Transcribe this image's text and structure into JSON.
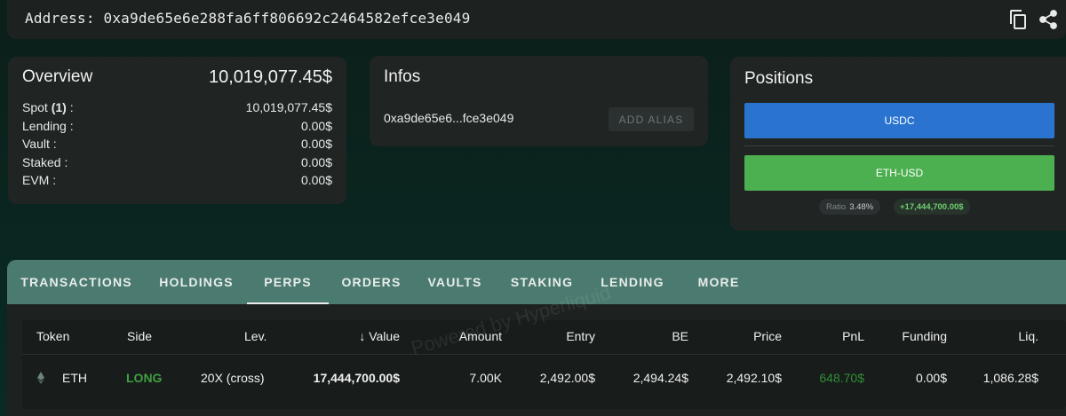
{
  "address_bar": {
    "label": "Address: 0xa9de65e6e288fa6ff806692c2464582efce3e049"
  },
  "overview": {
    "title": "Overview",
    "total": "10,019,077.45$",
    "rows": [
      {
        "label_pre": "Spot ",
        "label_bold": "(1)",
        "label_post": " :",
        "value": "10,019,077.45$"
      },
      {
        "label": "Lending :",
        "value": "0.00$"
      },
      {
        "label": "Vault :",
        "value": "0.00$"
      },
      {
        "label": "Staked :",
        "value": "0.00$"
      },
      {
        "label": "EVM :",
        "value": "0.00$"
      }
    ]
  },
  "infos": {
    "title": "Infos",
    "short_address": "0xa9de65e6...fce3e049",
    "add_alias_label": "ADD ALIAS"
  },
  "positions": {
    "title": "Positions",
    "usdc_label": "USDC",
    "eth_label": "ETH-USD",
    "ratio_label": "Ratio",
    "ratio_value": "3.48%",
    "pnl_value": "+17,444,700.00$"
  },
  "tabs": [
    "TRANSACTIONS",
    "HOLDINGS",
    "PERPS",
    "ORDERS",
    "VAULTS",
    "STAKING",
    "LENDING",
    "MORE"
  ],
  "active_tab": "PERPS",
  "table": {
    "headers": [
      "Token",
      "Side",
      "Lev.",
      "Value",
      "Amount",
      "Entry",
      "BE",
      "Price",
      "PnL",
      "Funding",
      "Liq."
    ],
    "sort_arrow": "↓",
    "rows": [
      {
        "token": "ETH",
        "side": "LONG",
        "lev": "20X (cross)",
        "value": "17,444,700.00$",
        "amount": "7.00K",
        "entry": "2,492.00$",
        "be": "2,494.24$",
        "price": "2,492.10$",
        "pnl": "648.70$",
        "funding": "0.00$",
        "liq": "1,086.28$"
      }
    ]
  },
  "watermark": "Powered by Hyperliquid",
  "colors": {
    "usdc": "#2a74d0",
    "eth": "#4caf50",
    "tab_bar": "#4b7b70",
    "long": "#3f9f42"
  }
}
